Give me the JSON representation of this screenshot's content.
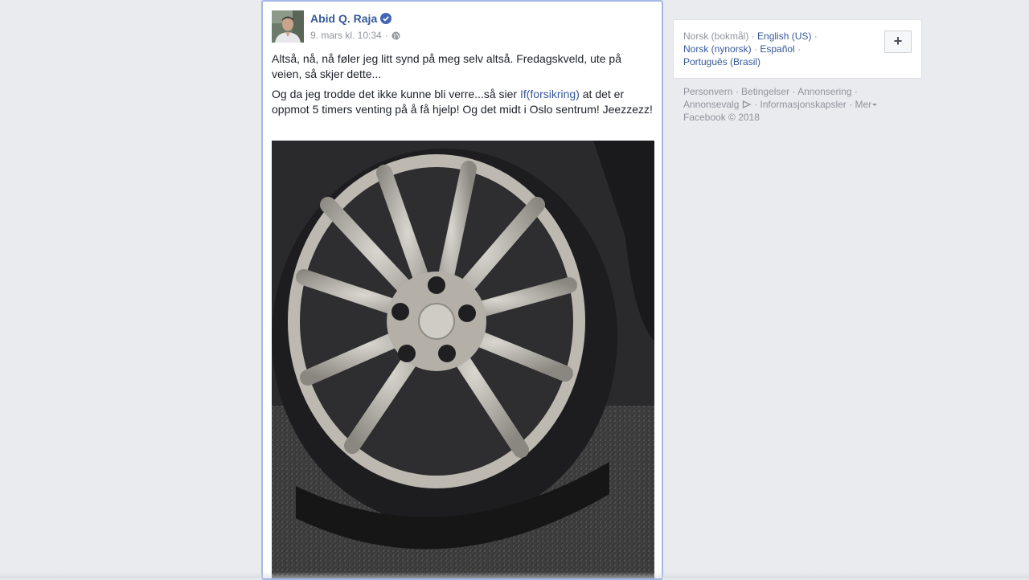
{
  "post": {
    "author_name": "Abid Q. Raja",
    "verified_icon": "verified-badge-icon",
    "timestamp": "9. mars kl. 10:34",
    "meta_separator": "·",
    "privacy_icon": "globe-icon",
    "paragraph1": "Altså, nå, nå føler jeg litt synd på meg selv altså. Fredagskveld, ute på veien, så skjer dette...",
    "paragraph2_before": "Og da jeg trodde det ikke kunne bli verre...så sier ",
    "paragraph2_link": "If(forsikring)",
    "paragraph2_after": " at det er oppmot 5 timers venting på å få hjelp! Og det midt i Oslo sentrum! Jeezzezz!",
    "photo_subject": "flat-tire-wheel-photo"
  },
  "languages": {
    "current": "Norsk (bokmål)",
    "options": [
      "English (US)",
      "Norsk (nynorsk)",
      "Español",
      "Português (Brasil)"
    ],
    "add_button": "+"
  },
  "footer": {
    "links": [
      "Personvern",
      "Betingelser",
      "Annonsering",
      "Annonsevalg",
      "Informasjonskapsler",
      "Mer"
    ],
    "copyright": "Facebook © 2018"
  },
  "colors": {
    "link": "#365899",
    "background": "#e9ebee",
    "muted": "#90949c",
    "verified": "#4267b2"
  }
}
